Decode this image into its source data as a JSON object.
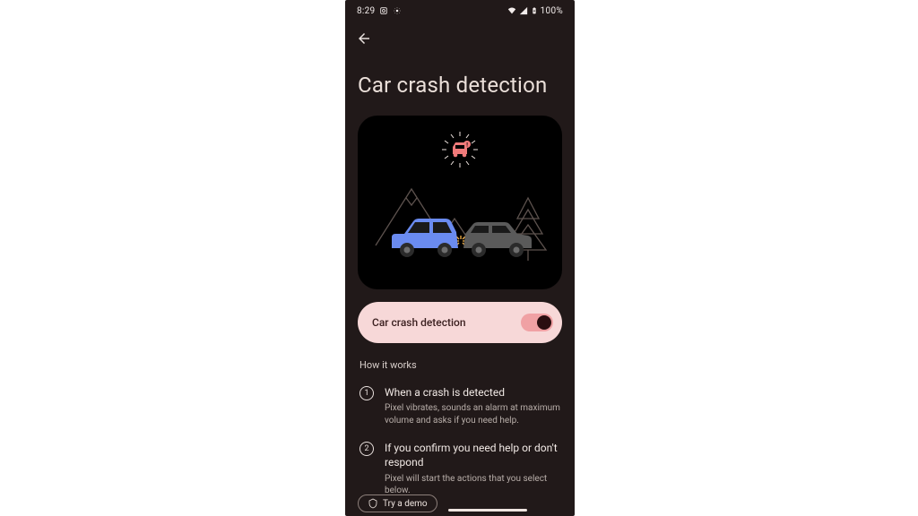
{
  "statusbar": {
    "time": "8:29",
    "battery": "100%"
  },
  "page": {
    "title": "Car crash detection"
  },
  "toggle": {
    "label": "Car crash detection",
    "on": true
  },
  "howitworks": {
    "heading": "How it works",
    "steps": [
      {
        "num": "1",
        "title": "When a crash is detected",
        "desc": "Pixel vibrates, sounds an alarm at maximum volume and asks if you need help."
      },
      {
        "num": "2",
        "title": "If you confirm you need help or don't respond",
        "desc": "Pixel will start the actions that you select below."
      }
    ]
  },
  "demo": {
    "label": "Try a demo"
  },
  "colors": {
    "bg": "#211919",
    "card": "#000000",
    "chip": "#f7d8d8",
    "accent": "#f0a1a4",
    "carBlue": "#6a8bf0",
    "carGrey": "#5a5a5a",
    "alert": "#f07a7a"
  }
}
